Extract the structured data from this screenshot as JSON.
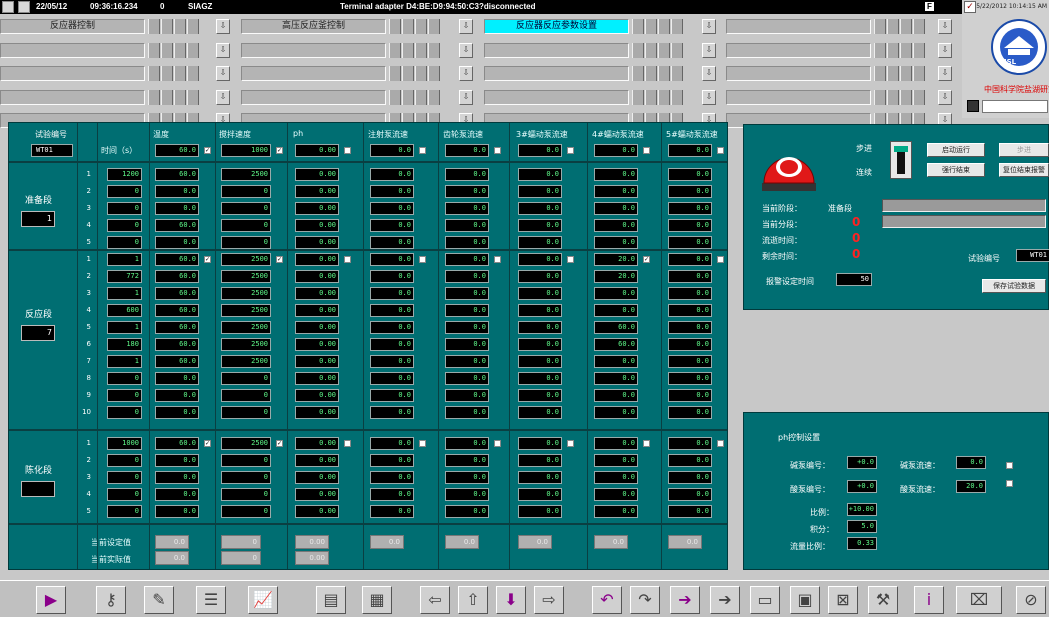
{
  "topbar": {
    "date": "22/05/12",
    "time": "09:36:16.234",
    "zero": "0",
    "user": "SIAGZ",
    "message": "Terminal adapter D4:BE:D9:94:50:C3?disconnected",
    "flag": "F"
  },
  "right_panel": {
    "datetime": "5/22/2012 10:14:15 AM",
    "org_name": "中国科学院盐湖研究所",
    "logo_text": "ISL"
  },
  "nav": {
    "tabs": [
      "反应器控制",
      "高压反应釜控制",
      "反应器反应参数设置",
      "",
      "",
      "",
      "",
      "",
      "",
      "",
      "",
      "",
      "",
      "",
      "",
      "",
      "",
      "",
      "",
      ""
    ],
    "active": 2
  },
  "main": {
    "test_no_label": "试验编号",
    "test_no_value": "WT01",
    "time_header": "时间（s）",
    "columns": [
      "温度",
      "搅拌速度",
      "ph",
      "注射泵流速",
      "齿轮泵流速",
      "3#蠕动泵流速",
      "4#蠕动泵流速",
      "5#蠕动泵流速"
    ],
    "col_header_values": [
      "60.0",
      "1000",
      "0.00",
      "0.0",
      "0.0",
      "0.0",
      "0.0",
      "0.0"
    ],
    "col_header_checks": [
      true,
      true,
      false,
      false,
      false,
      false,
      false,
      false
    ],
    "sections": [
      {
        "name": "准备段",
        "box": "1",
        "rows": [
          {
            "n": "1",
            "t": "1200",
            "v": [
              "60.0",
              "2500",
              "0.00",
              "0.0",
              "0.0",
              "0.0",
              "0.0",
              "0.0"
            ]
          },
          {
            "n": "2",
            "t": "0",
            "v": [
              "0.0",
              "0",
              "0.00",
              "0.0",
              "0.0",
              "0.0",
              "0.0",
              "0.0"
            ]
          },
          {
            "n": "3",
            "t": "0",
            "v": [
              "0.0",
              "0",
              "0.00",
              "0.0",
              "0.0",
              "0.0",
              "0.0",
              "0.0"
            ]
          },
          {
            "n": "4",
            "t": "0",
            "v": [
              "60.0",
              "0",
              "0.00",
              "0.0",
              "0.0",
              "0.0",
              "0.0",
              "0.0"
            ]
          },
          {
            "n": "5",
            "t": "0",
            "v": [
              "0.0",
              "0",
              "0.00",
              "0.0",
              "0.0",
              "0.0",
              "0.0",
              "0.0"
            ]
          }
        ]
      },
      {
        "name": "反应段",
        "box": "7",
        "rows": [
          {
            "n": "1",
            "t": "1",
            "v": [
              "60.0",
              "2500",
              "0.00",
              "0.0",
              "0.0",
              "0.0",
              "20.0",
              "0.0"
            ],
            "checks": [
              true,
              true,
              false,
              false,
              false,
              false,
              true,
              false
            ]
          },
          {
            "n": "2",
            "t": "772",
            "v": [
              "60.0",
              "2500",
              "0.00",
              "0.0",
              "0.0",
              "0.0",
              "20.0",
              "0.0"
            ]
          },
          {
            "n": "3",
            "t": "1",
            "v": [
              "60.0",
              "2500",
              "0.00",
              "0.0",
              "0.0",
              "0.0",
              "0.0",
              "0.0"
            ]
          },
          {
            "n": "4",
            "t": "600",
            "v": [
              "60.0",
              "2500",
              "0.00",
              "0.0",
              "0.0",
              "0.0",
              "0.0",
              "0.0"
            ]
          },
          {
            "n": "5",
            "t": "1",
            "v": [
              "60.0",
              "2500",
              "0.00",
              "0.0",
              "0.0",
              "0.0",
              "60.0",
              "0.0"
            ]
          },
          {
            "n": "6",
            "t": "180",
            "v": [
              "60.0",
              "2500",
              "0.00",
              "0.0",
              "0.0",
              "0.0",
              "60.0",
              "0.0"
            ]
          },
          {
            "n": "7",
            "t": "1",
            "v": [
              "60.0",
              "2500",
              "0.00",
              "0.0",
              "0.0",
              "0.0",
              "0.0",
              "0.0"
            ]
          },
          {
            "n": "8",
            "t": "0",
            "v": [
              "0.0",
              "0",
              "0.00",
              "0.0",
              "0.0",
              "0.0",
              "0.0",
              "0.0"
            ]
          },
          {
            "n": "9",
            "t": "0",
            "v": [
              "0.0",
              "0",
              "0.00",
              "0.0",
              "0.0",
              "0.0",
              "0.0",
              "0.0"
            ]
          },
          {
            "n": "10",
            "t": "0",
            "v": [
              "0.0",
              "0",
              "0.00",
              "0.0",
              "0.0",
              "0.0",
              "0.0",
              "0.0"
            ]
          }
        ]
      },
      {
        "name": "陈化段",
        "box": "",
        "rows": [
          {
            "n": "1",
            "t": "1000",
            "v": [
              "60.0",
              "2500",
              "0.00",
              "0.0",
              "0.0",
              "0.0",
              "0.0",
              "0.0"
            ],
            "checks": [
              true,
              true,
              false,
              false,
              false,
              false,
              false,
              false
            ]
          },
          {
            "n": "2",
            "t": "0",
            "v": [
              "0.0",
              "0",
              "0.00",
              "0.0",
              "0.0",
              "0.0",
              "0.0",
              "0.0"
            ]
          },
          {
            "n": "3",
            "t": "0",
            "v": [
              "0.0",
              "0",
              "0.00",
              "0.0",
              "0.0",
              "0.0",
              "0.0",
              "0.0"
            ]
          },
          {
            "n": "4",
            "t": "0",
            "v": [
              "0.0",
              "0",
              "0.00",
              "0.0",
              "0.0",
              "0.0",
              "0.0",
              "0.0"
            ]
          },
          {
            "n": "5",
            "t": "0",
            "v": [
              "0.0",
              "0",
              "0.00",
              "0.0",
              "0.0",
              "0.0",
              "0.0",
              "0.0"
            ]
          }
        ]
      }
    ],
    "setpoint_label": "当前设定值",
    "actual_label": "当前实际值",
    "setpoint_values": [
      "0.0",
      "0",
      "0.00",
      "0.0",
      "0.0",
      "0.0",
      "0.0",
      "0.0"
    ],
    "actual_values": [
      "0.0",
      "0",
      "0.00"
    ]
  },
  "status_panel": {
    "step_label": "步进",
    "cont_label": "连续",
    "btn_start": "启动运行",
    "btn_stop": "强行结束",
    "btn_next": "步进",
    "btn_reset": "复位结束报警",
    "stage_label": "当前阶段：",
    "stage_value": "准备段",
    "substage_label": "当前分段：",
    "elapsed_label": "流逝时间：",
    "remain_label": "剩余时间：",
    "counter_value": "0",
    "test_no_label": "试验编号",
    "test_no_value": "WT01",
    "alarm_label": "报警设定时间",
    "alarm_value": "50",
    "save_btn": "保存试验数据"
  },
  "ph_panel": {
    "title": "ph控制设置",
    "alkali_no_label": "碱泵编号：",
    "alkali_no": "+0.0",
    "acid_no_label": "酸泵编号：",
    "acid_no": "+0.0",
    "alkali_flow_label": "碱泵流速：",
    "alkali_flow": "0.0",
    "acid_flow_label": "酸泵流速：",
    "acid_flow": "20.0",
    "ratio_label": "比例：",
    "ratio": "+10.00",
    "integral_label": "积分：",
    "integral": "5.0",
    "flowratio_label": "流量比例：",
    "flowratio": "0.33"
  },
  "colors": {
    "panel": "#006e72",
    "entry_text": "#5ef98a",
    "active_tab": "#00f0ff",
    "alarm": "#e01818"
  },
  "toolbar_icons": [
    "play-icon",
    "key-icon",
    "notepad-icon",
    "document-list-icon",
    "chart-icon",
    "report-icon",
    "report-settings-icon",
    "arrow-left-icon",
    "arrow-up-icon",
    "arrow-down-icon",
    "arrow-right-icon",
    "undo-icon",
    "redo-icon",
    "goto-icon",
    "goto-disabled-icon",
    "window-icon",
    "window2-icon",
    "close-window-icon",
    "window-tools-icon",
    "info-icon",
    "exit-icon",
    "stop-icon"
  ]
}
